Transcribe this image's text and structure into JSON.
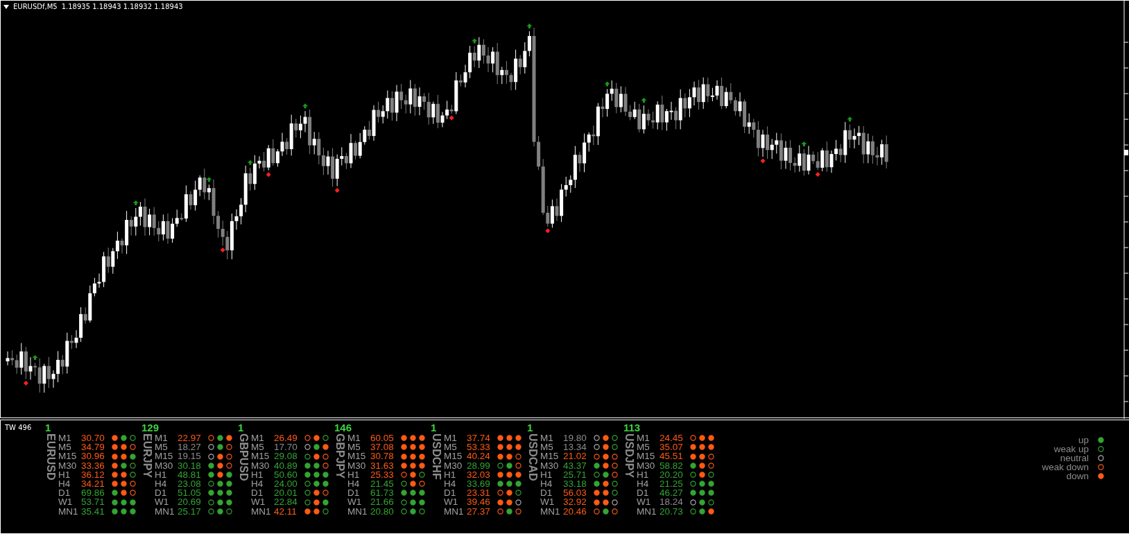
{
  "chart": {
    "symbol": "EURUSDf,M5",
    "quote": "1.18935 1.18943 1.18932 1.18943"
  },
  "indicator": {
    "label": "TW 496",
    "pairs": [
      {
        "count": "1",
        "name": "EURUSD",
        "rows": [
          {
            "tf": "M1",
            "value": "30.70",
            "color": "#ff5a14",
            "dots": [
              {
                "kind": "down"
              },
              {
                "kind": "up"
              },
              {
                "kind": "weak_up"
              }
            ]
          },
          {
            "tf": "M5",
            "value": "34.79",
            "color": "#ff5a14",
            "dots": [
              {
                "kind": "down"
              },
              {
                "kind": "down"
              },
              {
                "kind": "weak_down"
              }
            ]
          },
          {
            "tf": "M15",
            "value": "30.96",
            "color": "#ff5a14",
            "dots": [
              {
                "kind": "down"
              },
              {
                "kind": "down"
              },
              {
                "kind": "up"
              }
            ]
          },
          {
            "tf": "M30",
            "value": "33.36",
            "color": "#ff5a14",
            "dots": [
              {
                "kind": "down"
              },
              {
                "kind": "up"
              },
              {
                "kind": "weak_up"
              }
            ]
          },
          {
            "tf": "H1",
            "value": "36.12",
            "color": "#ff5a14",
            "dots": [
              {
                "kind": "down"
              },
              {
                "kind": "down"
              },
              {
                "kind": "weak_up"
              }
            ]
          },
          {
            "tf": "H4",
            "value": "34.21",
            "color": "#ff5a14",
            "dots": [
              {
                "kind": "down"
              },
              {
                "kind": "down"
              },
              {
                "kind": "weak_down"
              }
            ]
          },
          {
            "tf": "D1",
            "value": "69.86",
            "color": "#33a532",
            "dots": [
              {
                "kind": "up"
              },
              {
                "kind": "down"
              },
              {
                "kind": "weak_down"
              }
            ]
          },
          {
            "tf": "W1",
            "value": "53.71",
            "color": "#33a532",
            "dots": [
              {
                "kind": "up"
              },
              {
                "kind": "up"
              },
              {
                "kind": "up"
              }
            ]
          },
          {
            "tf": "MN1",
            "value": "35.41",
            "color": "#33a532",
            "dots": [
              {
                "kind": "up"
              },
              {
                "kind": "up"
              },
              {
                "kind": "up"
              }
            ]
          }
        ]
      },
      {
        "count": "129",
        "name": "EURJPY",
        "rows": [
          {
            "tf": "M1",
            "value": "22.97",
            "color": "#ff5a14",
            "dots": [
              {
                "kind": "weak_down"
              },
              {
                "kind": "up"
              },
              {
                "kind": "down"
              }
            ]
          },
          {
            "tf": "M5",
            "value": "18.27",
            "color": "#8c8c8c",
            "dots": [
              {
                "kind": "neutral"
              },
              {
                "kind": "up"
              },
              {
                "kind": "weak_down"
              }
            ]
          },
          {
            "tf": "M15",
            "value": "19.15",
            "color": "#8c8c8c",
            "dots": [
              {
                "kind": "neutral"
              },
              {
                "kind": "down"
              },
              {
                "kind": "weak_down"
              }
            ]
          },
          {
            "tf": "M30",
            "value": "30.18",
            "color": "#33a532",
            "dots": [
              {
                "kind": "up"
              },
              {
                "kind": "down"
              },
              {
                "kind": "weak_down"
              }
            ]
          },
          {
            "tf": "H1",
            "value": "48.81",
            "color": "#33a532",
            "dots": [
              {
                "kind": "up"
              },
              {
                "kind": "down"
              },
              {
                "kind": "up"
              }
            ]
          },
          {
            "tf": "H4",
            "value": "23.08",
            "color": "#33a532",
            "dots": [
              {
                "kind": "weak_up"
              },
              {
                "kind": "up"
              },
              {
                "kind": "up"
              }
            ]
          },
          {
            "tf": "D1",
            "value": "51.05",
            "color": "#33a532",
            "dots": [
              {
                "kind": "up"
              },
              {
                "kind": "up"
              },
              {
                "kind": "up"
              }
            ]
          },
          {
            "tf": "W1",
            "value": "20.69",
            "color": "#33a532",
            "dots": [
              {
                "kind": "weak_up"
              },
              {
                "kind": "up"
              },
              {
                "kind": "up"
              }
            ]
          },
          {
            "tf": "MN1",
            "value": "25.17",
            "color": "#33a532",
            "dots": [
              {
                "kind": "weak_up"
              },
              {
                "kind": "up"
              },
              {
                "kind": "weak_up"
              }
            ]
          }
        ]
      },
      {
        "count": "1",
        "name": "GBPUSD",
        "rows": [
          {
            "tf": "M1",
            "value": "26.49",
            "color": "#ff5a14",
            "dots": [
              {
                "kind": "weak_down"
              },
              {
                "kind": "down"
              },
              {
                "kind": "weak_up"
              }
            ]
          },
          {
            "tf": "M5",
            "value": "17.70",
            "color": "#8c8c8c",
            "dots": [
              {
                "kind": "neutral"
              },
              {
                "kind": "up"
              },
              {
                "kind": "down"
              }
            ]
          },
          {
            "tf": "M15",
            "value": "29.08",
            "color": "#33a532",
            "dots": [
              {
                "kind": "weak_up"
              },
              {
                "kind": "down"
              },
              {
                "kind": "weak_down"
              }
            ]
          },
          {
            "tf": "M30",
            "value": "40.89",
            "color": "#33a532",
            "dots": [
              {
                "kind": "up"
              },
              {
                "kind": "up"
              },
              {
                "kind": "weak_down"
              }
            ]
          },
          {
            "tf": "H1",
            "value": "50.60",
            "color": "#33a532",
            "dots": [
              {
                "kind": "up"
              },
              {
                "kind": "up"
              },
              {
                "kind": "up"
              }
            ]
          },
          {
            "tf": "H4",
            "value": "24.00",
            "color": "#33a532",
            "dots": [
              {
                "kind": "weak_up"
              },
              {
                "kind": "up"
              },
              {
                "kind": "up"
              }
            ]
          },
          {
            "tf": "D1",
            "value": "20.01",
            "color": "#33a532",
            "dots": [
              {
                "kind": "weak_up"
              },
              {
                "kind": "down"
              },
              {
                "kind": "weak_down"
              }
            ]
          },
          {
            "tf": "W1",
            "value": "22.84",
            "color": "#33a532",
            "dots": [
              {
                "kind": "weak_up"
              },
              {
                "kind": "down"
              },
              {
                "kind": "up"
              }
            ]
          },
          {
            "tf": "MN1",
            "value": "42.11",
            "color": "#ff5a14",
            "dots": [
              {
                "kind": "down"
              },
              {
                "kind": "down"
              },
              {
                "kind": "weak_up"
              }
            ]
          }
        ]
      },
      {
        "count": "146",
        "name": "GBPJPY",
        "rows": [
          {
            "tf": "M1",
            "value": "60.05",
            "color": "#ff5a14",
            "dots": [
              {
                "kind": "down"
              },
              {
                "kind": "down"
              },
              {
                "kind": "down"
              }
            ]
          },
          {
            "tf": "M5",
            "value": "37.08",
            "color": "#ff5a14",
            "dots": [
              {
                "kind": "down"
              },
              {
                "kind": "down"
              },
              {
                "kind": "down"
              }
            ]
          },
          {
            "tf": "M15",
            "value": "30.78",
            "color": "#ff5a14",
            "dots": [
              {
                "kind": "down"
              },
              {
                "kind": "down"
              },
              {
                "kind": "down"
              }
            ]
          },
          {
            "tf": "M30",
            "value": "31.63",
            "color": "#ff5a14",
            "dots": [
              {
                "kind": "down"
              },
              {
                "kind": "down"
              },
              {
                "kind": "down"
              }
            ]
          },
          {
            "tf": "H1",
            "value": "25.33",
            "color": "#ff5a14",
            "dots": [
              {
                "kind": "weak_down"
              },
              {
                "kind": "down"
              },
              {
                "kind": "weak_up"
              }
            ]
          },
          {
            "tf": "H4",
            "value": "21.45",
            "color": "#33a532",
            "dots": [
              {
                "kind": "weak_up"
              },
              {
                "kind": "down"
              },
              {
                "kind": "weak_down"
              }
            ]
          },
          {
            "tf": "D1",
            "value": "61.73",
            "color": "#33a532",
            "dots": [
              {
                "kind": "up"
              },
              {
                "kind": "up"
              },
              {
                "kind": "up"
              }
            ]
          },
          {
            "tf": "W1",
            "value": "21.66",
            "color": "#33a532",
            "dots": [
              {
                "kind": "weak_up"
              },
              {
                "kind": "up"
              },
              {
                "kind": "up"
              }
            ]
          },
          {
            "tf": "MN1",
            "value": "20.80",
            "color": "#33a532",
            "dots": [
              {
                "kind": "weak_up"
              },
              {
                "kind": "up"
              },
              {
                "kind": "weak_up"
              }
            ]
          }
        ]
      },
      {
        "count": "1",
        "name": "USDCHF",
        "rows": [
          {
            "tf": "M1",
            "value": "37.74",
            "color": "#ff5a14",
            "dots": [
              {
                "kind": "down"
              },
              {
                "kind": "down"
              },
              {
                "kind": "down"
              }
            ]
          },
          {
            "tf": "M5",
            "value": "53.33",
            "color": "#ff5a14",
            "dots": [
              {
                "kind": "down"
              },
              {
                "kind": "down"
              },
              {
                "kind": "down"
              }
            ]
          },
          {
            "tf": "M15",
            "value": "40.24",
            "color": "#ff5a14",
            "dots": [
              {
                "kind": "down"
              },
              {
                "kind": "down"
              },
              {
                "kind": "weak_down"
              }
            ]
          },
          {
            "tf": "M30",
            "value": "28.99",
            "color": "#33a532",
            "dots": [
              {
                "kind": "weak_up"
              },
              {
                "kind": "up"
              },
              {
                "kind": "weak_down"
              }
            ]
          },
          {
            "tf": "H1",
            "value": "32.03",
            "color": "#ff5a14",
            "dots": [
              {
                "kind": "down"
              },
              {
                "kind": "down"
              },
              {
                "kind": "down"
              }
            ]
          },
          {
            "tf": "H4",
            "value": "33.69",
            "color": "#33a532",
            "dots": [
              {
                "kind": "up"
              },
              {
                "kind": "up"
              },
              {
                "kind": "up"
              }
            ]
          },
          {
            "tf": "D1",
            "value": "23.31",
            "color": "#ff5a14",
            "dots": [
              {
                "kind": "weak_down"
              },
              {
                "kind": "down"
              },
              {
                "kind": "weak_up"
              }
            ]
          },
          {
            "tf": "W1",
            "value": "39.46",
            "color": "#ff5a14",
            "dots": [
              {
                "kind": "down"
              },
              {
                "kind": "down"
              },
              {
                "kind": "neutral"
              }
            ]
          },
          {
            "tf": "MN1",
            "value": "27.37",
            "color": "#ff5a14",
            "dots": [
              {
                "kind": "weak_down"
              },
              {
                "kind": "up"
              },
              {
                "kind": "weak_down"
              }
            ]
          }
        ]
      },
      {
        "count": "1",
        "name": "USDCAD",
        "rows": [
          {
            "tf": "M1",
            "value": "19.80",
            "color": "#8c8c8c",
            "dots": [
              {
                "kind": "neutral"
              },
              {
                "kind": "down"
              },
              {
                "kind": "weak_up"
              }
            ]
          },
          {
            "tf": "M5",
            "value": "13.34",
            "color": "#8c8c8c",
            "dots": [
              {
                "kind": "neutral"
              },
              {
                "kind": "down"
              },
              {
                "kind": "weak_up"
              }
            ]
          },
          {
            "tf": "M15",
            "value": "21.02",
            "color": "#ff5a14",
            "dots": [
              {
                "kind": "weak_down"
              },
              {
                "kind": "down"
              },
              {
                "kind": "weak_down"
              }
            ]
          },
          {
            "tf": "M30",
            "value": "43.37",
            "color": "#33a532",
            "dots": [
              {
                "kind": "up"
              },
              {
                "kind": "down"
              },
              {
                "kind": "weak_down"
              }
            ]
          },
          {
            "tf": "H1",
            "value": "25.71",
            "color": "#33a532",
            "dots": [
              {
                "kind": "weak_up"
              },
              {
                "kind": "up"
              },
              {
                "kind": "weak_down"
              }
            ]
          },
          {
            "tf": "H4",
            "value": "33.18",
            "color": "#33a532",
            "dots": [
              {
                "kind": "up"
              },
              {
                "kind": "down"
              },
              {
                "kind": "weak_up"
              }
            ]
          },
          {
            "tf": "D1",
            "value": "56.03",
            "color": "#ff5a14",
            "dots": [
              {
                "kind": "down"
              },
              {
                "kind": "down"
              },
              {
                "kind": "weak_up"
              }
            ]
          },
          {
            "tf": "W1",
            "value": "32.92",
            "color": "#ff5a14",
            "dots": [
              {
                "kind": "down"
              },
              {
                "kind": "down"
              },
              {
                "kind": "neutral"
              }
            ]
          },
          {
            "tf": "MN1",
            "value": "20.46",
            "color": "#ff5a14",
            "dots": [
              {
                "kind": "weak_down"
              },
              {
                "kind": "up"
              },
              {
                "kind": "weak_down"
              }
            ]
          }
        ]
      },
      {
        "count": "113",
        "name": "USDJPY",
        "rows": [
          {
            "tf": "M1",
            "value": "24.45",
            "color": "#ff5a14",
            "dots": [
              {
                "kind": "weak_down"
              },
              {
                "kind": "down"
              },
              {
                "kind": "down"
              }
            ]
          },
          {
            "tf": "M5",
            "value": "35.07",
            "color": "#ff5a14",
            "dots": [
              {
                "kind": "down"
              },
              {
                "kind": "down"
              },
              {
                "kind": "down"
              }
            ]
          },
          {
            "tf": "M15",
            "value": "45.51",
            "color": "#ff5a14",
            "dots": [
              {
                "kind": "down"
              },
              {
                "kind": "down"
              },
              {
                "kind": "weak_down"
              }
            ]
          },
          {
            "tf": "M30",
            "value": "58.82",
            "color": "#33a532",
            "dots": [
              {
                "kind": "up"
              },
              {
                "kind": "down"
              },
              {
                "kind": "weak_down"
              }
            ]
          },
          {
            "tf": "H1",
            "value": "20.20",
            "color": "#33a532",
            "dots": [
              {
                "kind": "weak_up"
              },
              {
                "kind": "down"
              },
              {
                "kind": "weak_up"
              }
            ]
          },
          {
            "tf": "H4",
            "value": "21.25",
            "color": "#33a532",
            "dots": [
              {
                "kind": "weak_up"
              },
              {
                "kind": "up"
              },
              {
                "kind": "up"
              }
            ]
          },
          {
            "tf": "D1",
            "value": "46.27",
            "color": "#33a532",
            "dots": [
              {
                "kind": "up"
              },
              {
                "kind": "up"
              },
              {
                "kind": "up"
              }
            ]
          },
          {
            "tf": "W1",
            "value": "18.24",
            "color": "#8c8c8c",
            "dots": [
              {
                "kind": "neutral"
              },
              {
                "kind": "up"
              },
              {
                "kind": "weak_up"
              }
            ]
          },
          {
            "tf": "MN1",
            "value": "20.73",
            "color": "#33a532",
            "dots": [
              {
                "kind": "weak_up"
              },
              {
                "kind": "up"
              },
              {
                "kind": "down"
              }
            ]
          }
        ]
      }
    ],
    "legend": [
      {
        "label": "up",
        "kind": "up"
      },
      {
        "label": "weak up",
        "kind": "weak_up"
      },
      {
        "label": "neutral",
        "kind": "neutral"
      },
      {
        "label": "weak down",
        "kind": "weak_down"
      },
      {
        "label": "down",
        "kind": "down"
      }
    ]
  }
}
